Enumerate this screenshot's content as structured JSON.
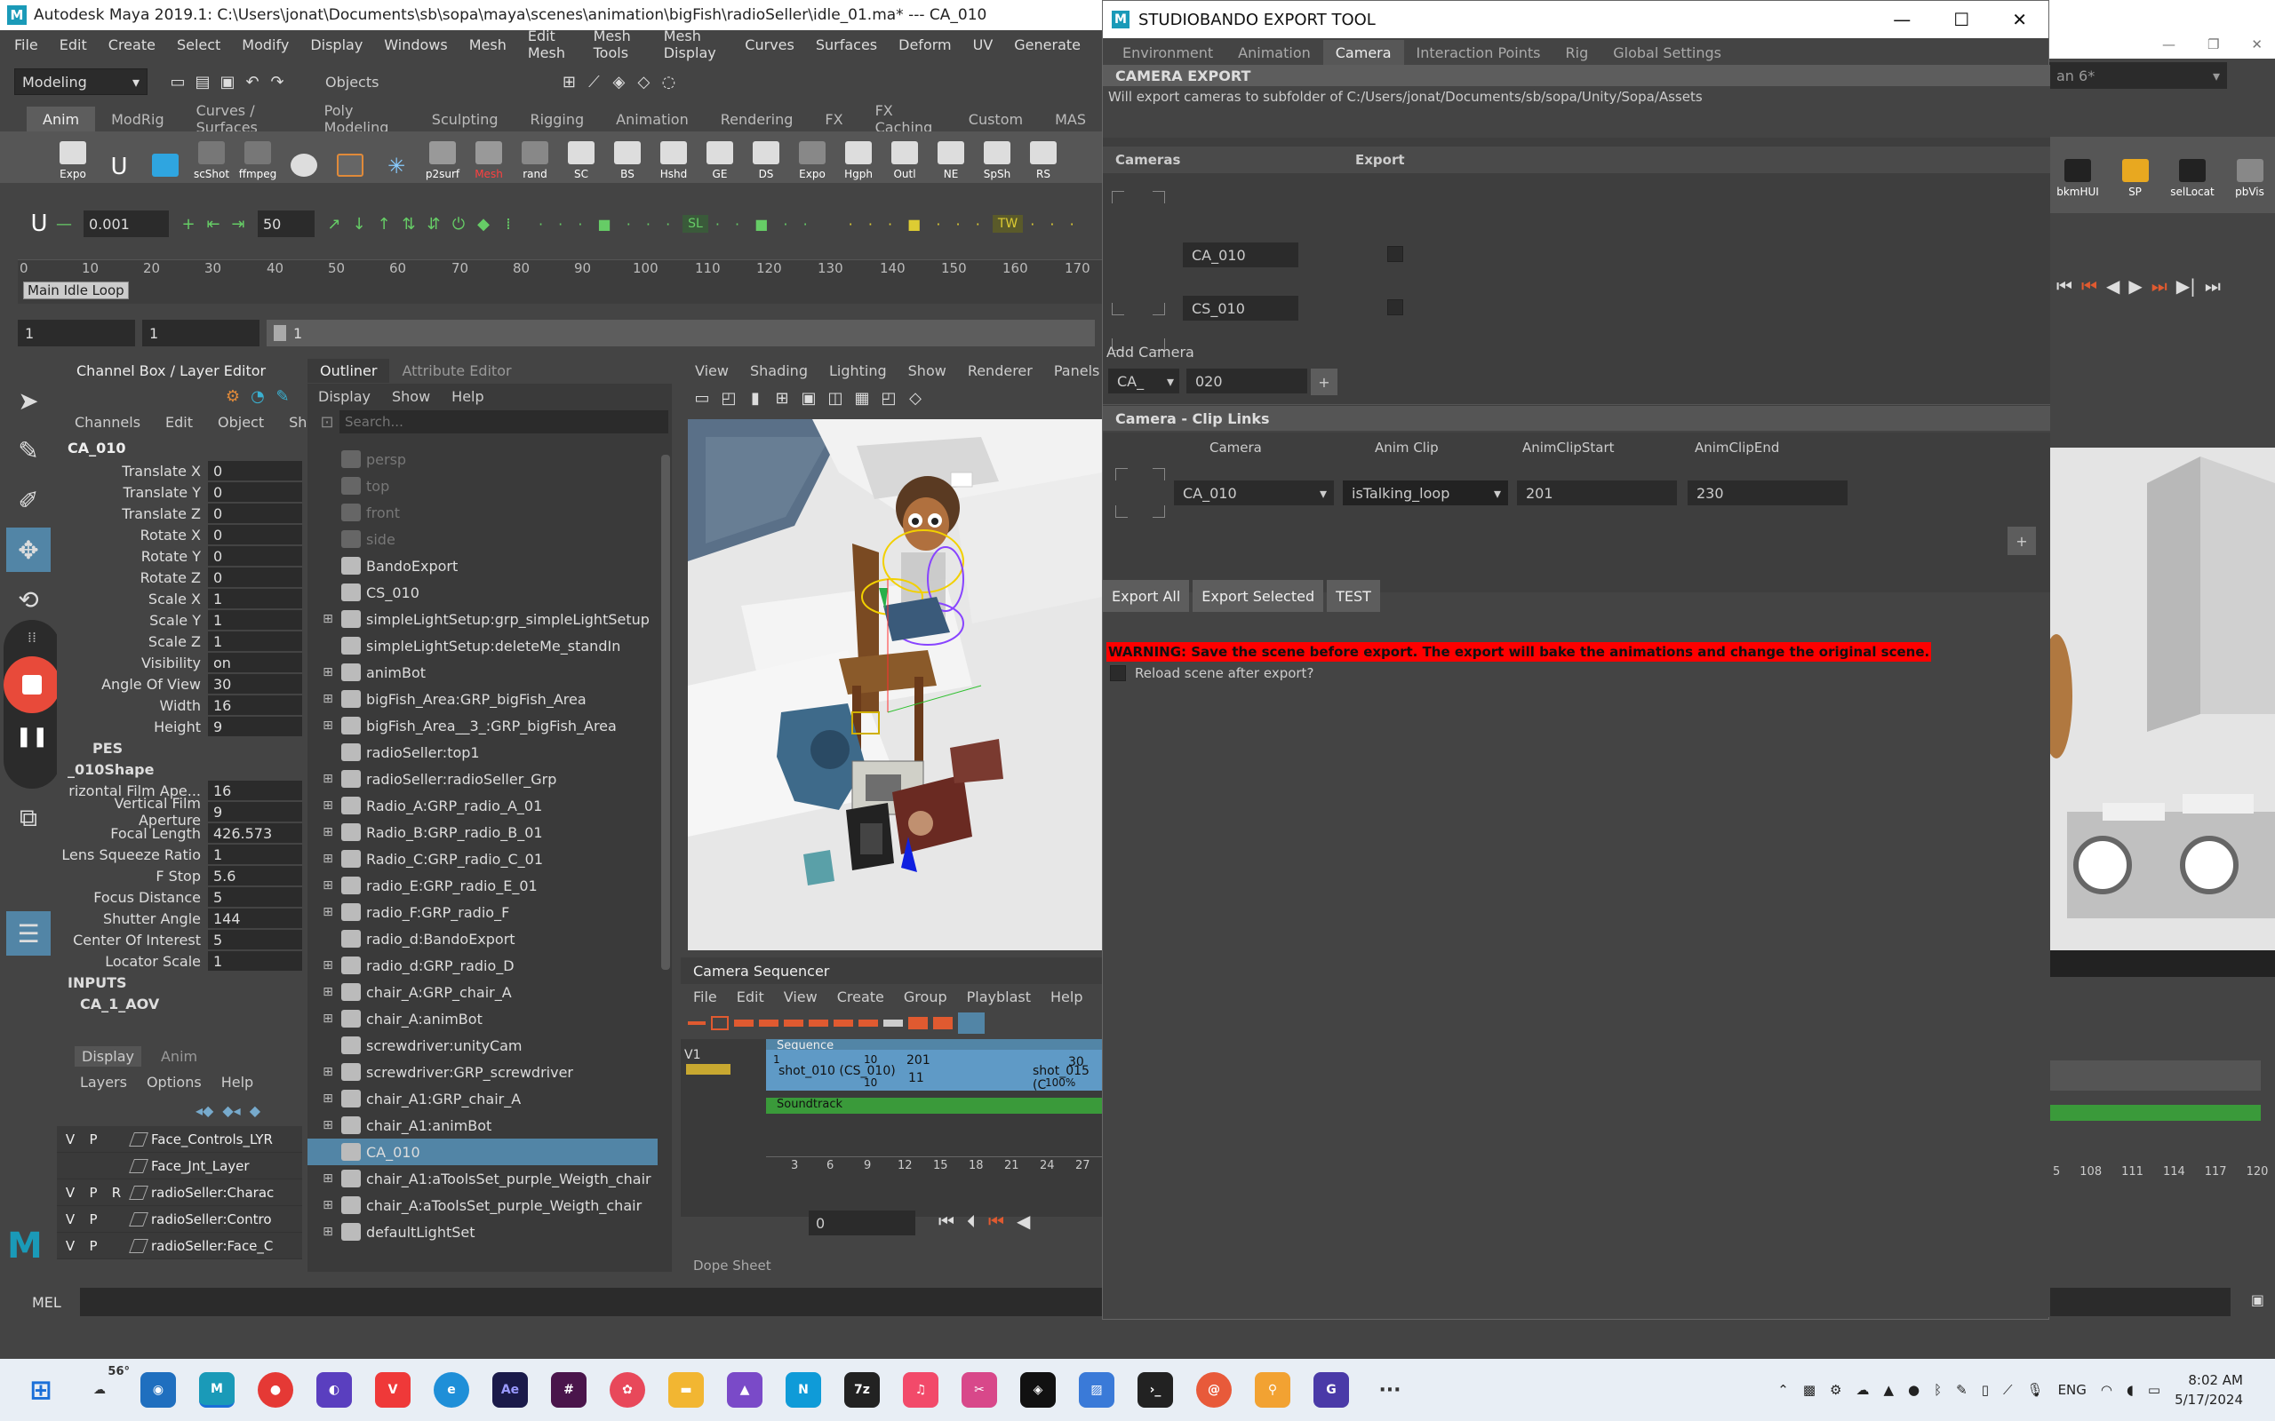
{
  "maya": {
    "title": "Autodesk Maya 2019.1: C:\\Users\\jonat\\Documents\\sb\\sopa\\maya\\scenes\\animation\\bigFish\\radioSeller\\idle_01.ma*   ---   CA_010",
    "menu": [
      "File",
      "Edit",
      "Create",
      "Select",
      "Modify",
      "Display",
      "Windows",
      "Mesh",
      "Edit Mesh",
      "Mesh Tools",
      "Mesh Display",
      "Curves",
      "Surfaces",
      "Deform",
      "UV",
      "Generate"
    ],
    "mode_dropdown": "Modeling",
    "objects_label": "Objects",
    "shelf_tabs": [
      "Anim",
      "ModRig",
      "Curves / Surfaces",
      "Poly Modeling",
      "Sculpting",
      "Rigging",
      "Animation",
      "Rendering",
      "FX",
      "FX Caching",
      "Custom",
      "MAS"
    ],
    "shelf_buttons": [
      "Expo",
      "",
      "",
      "scShot",
      "ffmpeg",
      "",
      "",
      "",
      "p2surf",
      "Mesh",
      "rand",
      "SC",
      "BS",
      "Hshd",
      "GE",
      "DS",
      "Expo",
      "Hgph",
      "Outl",
      "NE",
      "SpSh",
      "RS"
    ],
    "right_shelf_buttons": [
      "bkmHUI",
      "SP",
      "selLocat",
      "pbVis"
    ],
    "step_value": "0.001",
    "step_value2": "50",
    "sl_label": "SL",
    "tw_label": "TW",
    "timeline_ticks": [
      "0",
      "10",
      "20",
      "30",
      "40",
      "50",
      "60",
      "70",
      "80",
      "90",
      "100",
      "110",
      "120",
      "130",
      "140",
      "150",
      "160",
      "170"
    ],
    "timeline_label": "Main Idle Loop",
    "range_start": "1",
    "range_start2": "1",
    "range_field": "1",
    "channelbox": {
      "tab_title": "Channel Box / Layer Editor",
      "menus": [
        "Channels",
        "Edit",
        "Object",
        "Show"
      ],
      "object": "CA_010",
      "channels": [
        {
          "label": "Translate X",
          "value": "0"
        },
        {
          "label": "Translate Y",
          "value": "0"
        },
        {
          "label": "Translate Z",
          "value": "0"
        },
        {
          "label": "Rotate X",
          "value": "0"
        },
        {
          "label": "Rotate Y",
          "value": "0"
        },
        {
          "label": "Rotate Z",
          "value": "0"
        },
        {
          "label": "Scale X",
          "value": "1"
        },
        {
          "label": "Scale Y",
          "value": "1"
        },
        {
          "label": "Scale Z",
          "value": "1"
        },
        {
          "label": "Visibility",
          "value": "on"
        },
        {
          "label": "Angle Of View",
          "value": "30"
        },
        {
          "label": "Width",
          "value": "16"
        },
        {
          "label": "Height",
          "value": "9"
        }
      ],
      "shapes_header": "PES",
      "shape_name": "_010Shape",
      "shape_channels": [
        {
          "label": "rizontal Film Ape...",
          "value": "16"
        },
        {
          "label": "Vertical Film Aperture",
          "value": "9"
        },
        {
          "label": "Focal Length",
          "value": "426.573"
        },
        {
          "label": "Lens Squeeze Ratio",
          "value": "1"
        },
        {
          "label": "F Stop",
          "value": "5.6"
        },
        {
          "label": "Focus Distance",
          "value": "5"
        },
        {
          "label": "Shutter Angle",
          "value": "144"
        },
        {
          "label": "Center Of Interest",
          "value": "5"
        },
        {
          "label": "Locator Scale",
          "value": "1"
        }
      ],
      "inputs_header": "INPUTS",
      "input_name": "CA_1_AOV",
      "layer_tabs": [
        "Display",
        "Anim"
      ],
      "layer_menus": [
        "Layers",
        "Options",
        "Help"
      ],
      "layers": [
        {
          "v": "V",
          "p": "P",
          "r": "",
          "name": "Face_Controls_LYR"
        },
        {
          "v": "",
          "p": "",
          "r": "",
          "name": "Face_Jnt_Layer"
        },
        {
          "v": "V",
          "p": "P",
          "r": "R",
          "name": "radioSeller:Charac"
        },
        {
          "v": "V",
          "p": "P",
          "r": "",
          "name": "radioSeller:Contro"
        },
        {
          "v": "V",
          "p": "P",
          "r": "",
          "name": "radioSeller:Face_C"
        }
      ]
    },
    "outliner": {
      "tabs": [
        "Outliner",
        "Attribute Editor"
      ],
      "menus": [
        "Display",
        "Show",
        "Help"
      ],
      "search_placeholder": "Search...",
      "items": [
        {
          "name": "persp",
          "plus": false,
          "dim": true,
          "sel": false
        },
        {
          "name": "top",
          "plus": false,
          "dim": true,
          "sel": false
        },
        {
          "name": "front",
          "plus": false,
          "dim": true,
          "sel": false
        },
        {
          "name": "side",
          "plus": false,
          "dim": true,
          "sel": false
        },
        {
          "name": "BandoExport",
          "plus": false,
          "dim": false,
          "sel": false
        },
        {
          "name": "CS_010",
          "plus": false,
          "dim": false,
          "sel": false
        },
        {
          "name": "simpleLightSetup:grp_simpleLightSetup",
          "plus": true,
          "dim": false,
          "sel": false
        },
        {
          "name": "simpleLightSetup:deleteMe_standIn",
          "plus": false,
          "dim": false,
          "sel": false
        },
        {
          "name": "animBot",
          "plus": true,
          "dim": false,
          "sel": false
        },
        {
          "name": "bigFish_Area:GRP_bigFish_Area",
          "plus": true,
          "dim": false,
          "sel": false
        },
        {
          "name": "bigFish_Area__3_:GRP_bigFish_Area",
          "plus": true,
          "dim": false,
          "sel": false
        },
        {
          "name": "radioSeller:top1",
          "plus": false,
          "dim": false,
          "sel": false
        },
        {
          "name": "radioSeller:radioSeller_Grp",
          "plus": true,
          "dim": false,
          "sel": false
        },
        {
          "name": "Radio_A:GRP_radio_A_01",
          "plus": true,
          "dim": false,
          "sel": false
        },
        {
          "name": "Radio_B:GRP_radio_B_01",
          "plus": true,
          "dim": false,
          "sel": false
        },
        {
          "name": "Radio_C:GRP_radio_C_01",
          "plus": true,
          "dim": false,
          "sel": false
        },
        {
          "name": "radio_E:GRP_radio_E_01",
          "plus": true,
          "dim": false,
          "sel": false
        },
        {
          "name": "radio_F:GRP_radio_F",
          "plus": true,
          "dim": false,
          "sel": false
        },
        {
          "name": "radio_d:BandoExport",
          "plus": false,
          "dim": false,
          "sel": false
        },
        {
          "name": "radio_d:GRP_radio_D",
          "plus": true,
          "dim": false,
          "sel": false
        },
        {
          "name": "chair_A:GRP_chair_A",
          "plus": true,
          "dim": false,
          "sel": false
        },
        {
          "name": "chair_A:animBot",
          "plus": true,
          "dim": false,
          "sel": false
        },
        {
          "name": "screwdriver:unityCam",
          "plus": false,
          "dim": false,
          "sel": false
        },
        {
          "name": "screwdriver:GRP_screwdriver",
          "plus": true,
          "dim": false,
          "sel": false
        },
        {
          "name": "chair_A1:GRP_chair_A",
          "plus": true,
          "dim": false,
          "sel": false
        },
        {
          "name": "chair_A1:animBot",
          "plus": true,
          "dim": false,
          "sel": false
        },
        {
          "name": "CA_010",
          "plus": false,
          "dim": false,
          "sel": true
        },
        {
          "name": "chair_A1:aToolsSet_purple_Weigth_chair",
          "plus": true,
          "dim": false,
          "sel": false
        },
        {
          "name": "chair_A:aToolsSet_purple_Weigth_chair",
          "plus": true,
          "dim": false,
          "sel": false
        },
        {
          "name": "defaultLightSet",
          "plus": true,
          "dim": false,
          "sel": false
        }
      ]
    },
    "viewport": {
      "menus": [
        "View",
        "Shading",
        "Lighting",
        "Show",
        "Renderer",
        "Panels"
      ]
    },
    "sequencer": {
      "title": "Camera Sequencer",
      "menus": [
        "File",
        "Edit",
        "View",
        "Create",
        "Group",
        "Playblast",
        "Help"
      ],
      "track_label": "V1",
      "sequence_label": "Sequence",
      "shot1": "shot_010 (CS_010)",
      "shot1_start": "1",
      "shot1_end": "10",
      "shot1_end2": "10",
      "shot2_start": "201",
      "shot2_sub": "11",
      "shot2": "shot_015 (C",
      "shot2_pct": "100%",
      "shot2_end": "30",
      "soundtrack_label": "Soundtrack",
      "ruler": [
        "3",
        "6",
        "9",
        "12",
        "15",
        "18",
        "21",
        "24",
        "27"
      ],
      "frame_value": "0",
      "dope_sheet": "Dope Sheet"
    },
    "right_ruler": [
      "5",
      "108",
      "111",
      "114",
      "117",
      "120"
    ],
    "mel_label": "MEL"
  },
  "dialog": {
    "title": "STUDIOBANDO EXPORT TOOL",
    "tabs": [
      "Environment",
      "Animation",
      "Camera",
      "Interaction Points",
      "Rig",
      "Global Settings"
    ],
    "active_tab": "Camera",
    "camera_export_header": "CAMERA EXPORT",
    "export_path_note": "Will export cameras to subfolder of C:/Users/jonat/Documents/sb/sopa/Unity/Sopa/Assets",
    "cameras_col": "Cameras",
    "export_col": "Export",
    "cameras": [
      "CA_010",
      "CS_010"
    ],
    "add_camera_label": "Add Camera",
    "add_camera_prefix": "CA_",
    "add_camera_number": "020",
    "add_button": "+",
    "clip_links_header": "Camera - Clip Links",
    "clip_cols": [
      "Camera",
      "Anim Clip",
      "AnimClipStart",
      "AnimClipEnd"
    ],
    "clip_row": {
      "camera": "CA_010",
      "clip": "isTalking_loop",
      "start": "201",
      "end": "230"
    },
    "add_clip_button": "+",
    "buttons": [
      "Export All",
      "Export Selected",
      "TEST"
    ],
    "warning": "WARNING: Save the scene before export. The export will bake the animations and change the original scene.",
    "reload_label": "Reload scene after export?",
    "warning_color": "#ff0000"
  },
  "right_panel": {
    "dropdown": "an 6*"
  },
  "taskbar": {
    "weather": "56°",
    "lang": "ENG",
    "time": "8:02 AM",
    "date": "5/17/2024",
    "apps": [
      "start",
      "weather",
      "search",
      "maya",
      "chrome",
      "app1",
      "vivaldi",
      "edge",
      "ae",
      "slack",
      "app2",
      "explorer",
      "affinity",
      "onenote",
      "7z",
      "music",
      "snip",
      "figma",
      "photos",
      "terminal",
      "curl",
      "search2",
      "todo",
      "more"
    ]
  }
}
